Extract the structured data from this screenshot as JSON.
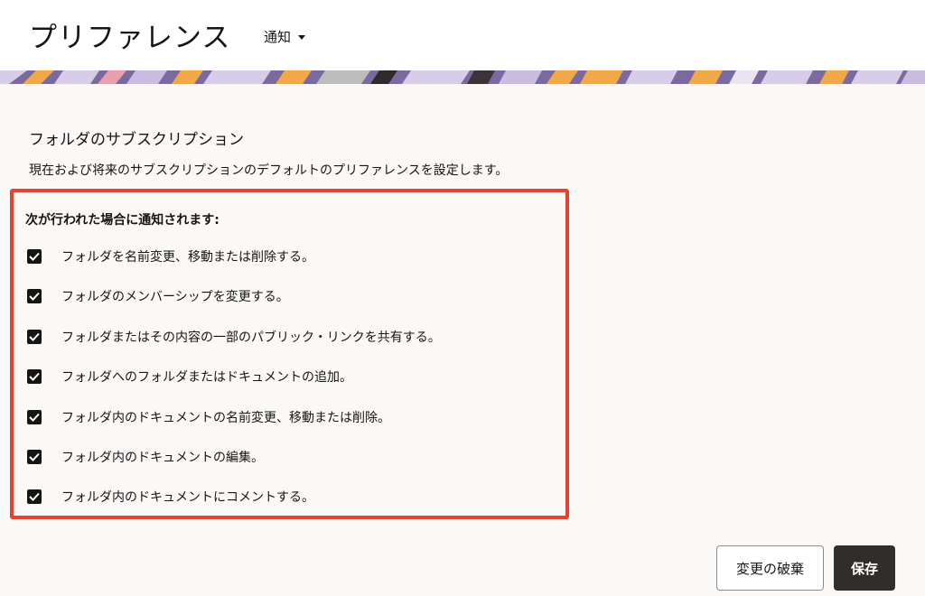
{
  "header": {
    "app_title": "プリファレンス",
    "menu_label": "通知"
  },
  "colors": {
    "highlight_border": "#e5432f",
    "banner_primary": "#7b6aa0",
    "save_button_bg": "#312d2a"
  },
  "section": {
    "title": "フォルダのサブスクリプション",
    "description": "現在および将来のサブスクリプションのデフォルトのプリファレンスを設定します。",
    "group_label": "次が行われた場合に通知されます:",
    "options": [
      {
        "label": "フォルダを名前変更、移動または削除する。",
        "checked": true
      },
      {
        "label": "フォルダのメンバーシップを変更する。",
        "checked": true
      },
      {
        "label": "フォルダまたはその内容の一部のパブリック・リンクを共有する。",
        "checked": true
      },
      {
        "label": "フォルダへのフォルダまたはドキュメントの追加。",
        "checked": true
      },
      {
        "label": "フォルダ内のドキュメントの名前変更、移動または削除。",
        "checked": true
      },
      {
        "label": "フォルダ内のドキュメントの編集。",
        "checked": true
      },
      {
        "label": "フォルダ内のドキュメントにコメントする。",
        "checked": true
      }
    ]
  },
  "actions": {
    "discard_label": "変更の破棄",
    "save_label": "保存"
  }
}
